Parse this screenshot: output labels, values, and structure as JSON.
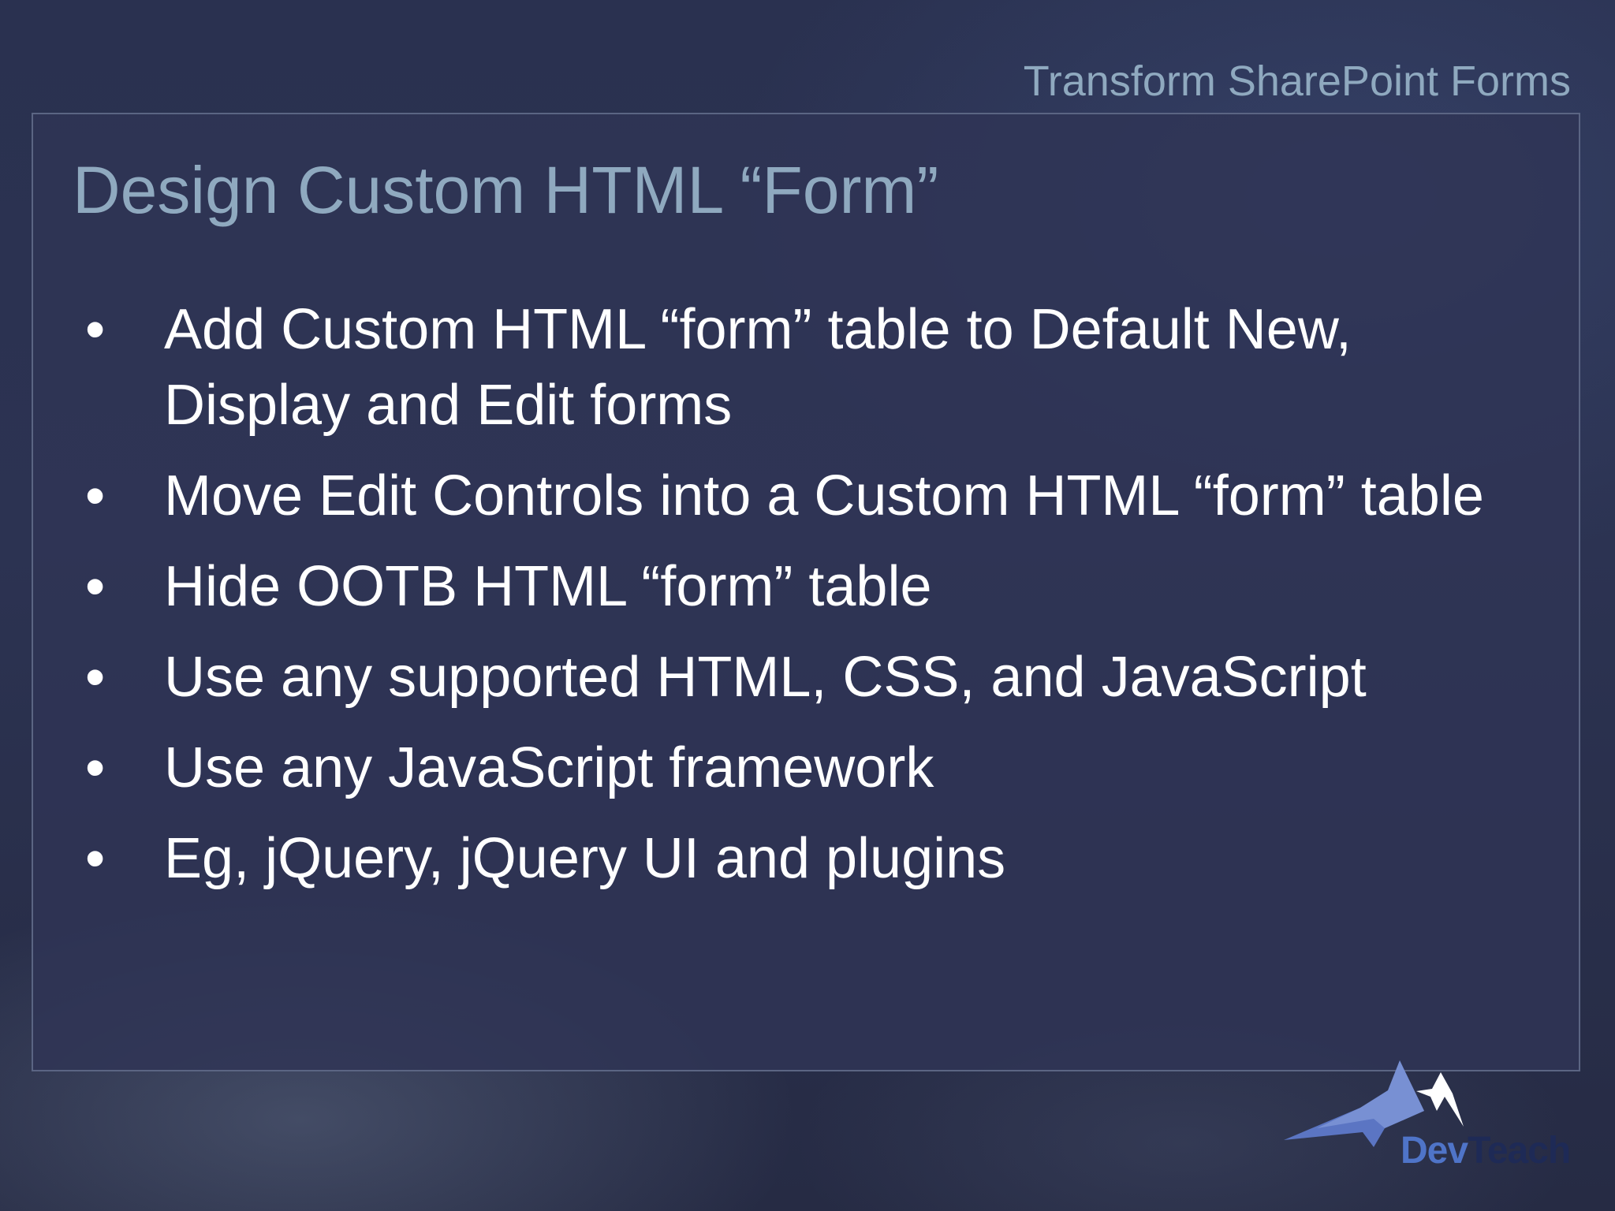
{
  "header": {
    "title": "Transform SharePoint Forms"
  },
  "slide": {
    "title": "Design Custom HTML “Form”",
    "bullet_symbol": "•",
    "bullets": [
      "Add Custom HTML “form” table to Default New, Display and Edit forms",
      "Move Edit Controls into a Custom HTML “form” table",
      "Hide OOTB HTML “form” table",
      "Use any supported HTML, CSS, and JavaScript",
      "Use any JavaScript framework",
      "Eg, jQuery, jQuery UI and plugins"
    ]
  },
  "logo": {
    "part1": "Dev",
    "part2": "Teach",
    "icon": "devteach-star-icon",
    "colors": {
      "dev": "#4f74c8",
      "teach": "#1e2a56",
      "star_blue": "#5e79c9",
      "star_white": "#ffffff"
    }
  },
  "colors": {
    "background": "#2b3252",
    "panel": "#303456",
    "panel_border": "#5b6583",
    "title": "#8fa9bf",
    "body_text": "#ffffff"
  }
}
